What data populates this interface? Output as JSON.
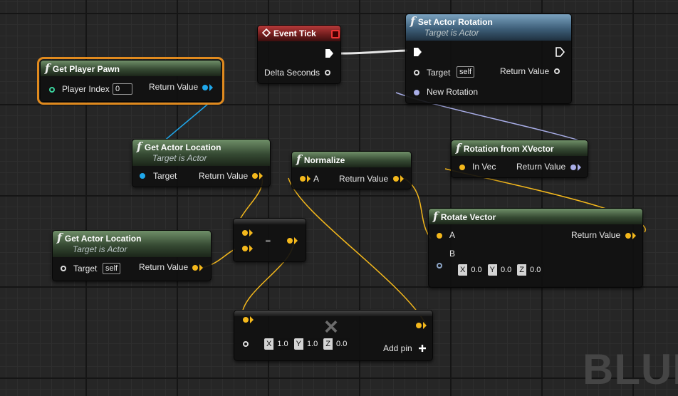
{
  "watermark": "BLUE",
  "colors": {
    "float_pin": "#f4b81c",
    "object_pin": "#1fa7ea",
    "rotator_pin": "#a9aee8",
    "delta_pin": "#9be36f",
    "selection": "#e08a1e",
    "event_header": "#8b2222",
    "target_header": "#5a7f9c",
    "pure_header": "#4a6845"
  },
  "icons": {
    "function": "function-icon",
    "event": "event-diamond-icon",
    "exec": "exec-pin-icon",
    "close": "close-icon",
    "add": "plus-icon"
  },
  "nodes": {
    "event_tick": {
      "title": "Event Tick",
      "delta_label": "Delta Seconds"
    },
    "get_player_pawn": {
      "title": "Get Player Pawn",
      "player_index_label": "Player Index",
      "player_index_value": "0",
      "return_label": "Return Value"
    },
    "set_actor_rotation": {
      "title": "Set Actor Rotation",
      "subtitle": "Target is Actor",
      "target_label": "Target",
      "target_value": "self",
      "return_label": "Return Value",
      "new_rotation_label": "New Rotation"
    },
    "get_actor_location_1": {
      "title": "Get Actor Location",
      "subtitle": "Target is Actor",
      "target_label": "Target",
      "return_label": "Return Value"
    },
    "normalize": {
      "title": "Normalize",
      "a_label": "A",
      "return_label": "Return Value"
    },
    "rotation_from_xvector": {
      "title": "Rotation from XVector",
      "in_label": "In Vec",
      "return_label": "Return Value"
    },
    "rotate_vector": {
      "title": "Rotate Vector",
      "a_label": "A",
      "b_label": "B",
      "return_label": "Return Value",
      "b_x_label": "X",
      "b_x": "0.0",
      "b_y_label": "Y",
      "b_y": "0.0",
      "b_z_label": "Z",
      "b_z": "0.0"
    },
    "get_actor_location_2": {
      "title": "Get Actor Location",
      "subtitle": "Target is Actor",
      "target_label": "Target",
      "target_value": "self",
      "return_label": "Return Value"
    },
    "subtract": {
      "operator": "-"
    },
    "multiply": {
      "operator": "×",
      "x_label": "X",
      "x": "1.0",
      "y_label": "Y",
      "y": "1.0",
      "z_label": "Z",
      "z": "0.0",
      "add_pin_label": "Add pin"
    }
  }
}
